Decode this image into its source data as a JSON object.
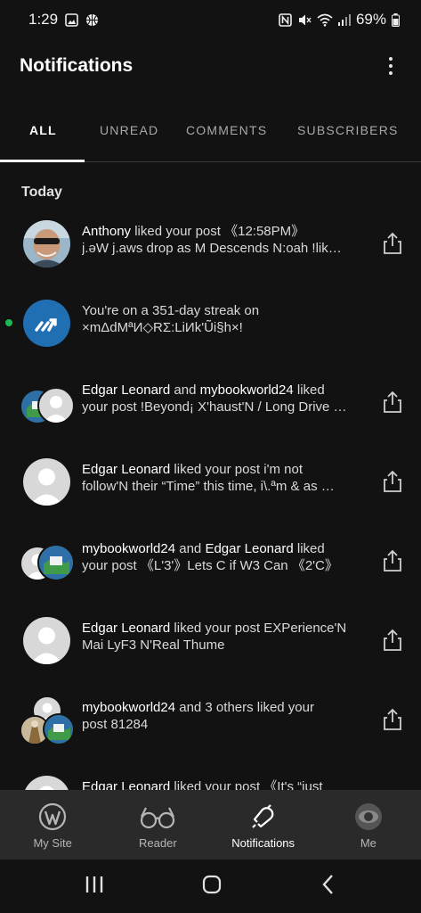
{
  "status_bar": {
    "time": "1:29",
    "battery": "69%"
  },
  "header": {
    "title": "Notifications"
  },
  "tabs": [
    {
      "label": "ALL"
    },
    {
      "label": "UNREAD"
    },
    {
      "label": "COMMENTS"
    },
    {
      "label": "SUBSCRIBERS"
    }
  ],
  "section": {
    "today": "Today"
  },
  "notifications": [
    {
      "line1_name": "Anthony",
      "line1_rest": " liked your post 《12:58PM》",
      "line2": "j.əW j.aws drop as M Descends N:oah !lik…"
    },
    {
      "line1_name": "",
      "line1_rest": "You're on a 351-day streak on",
      "line2": "×mΔdMªИ◇RΣ:LiИk'Ũi§h×!"
    },
    {
      "line1_name": "Edgar Leonard",
      "line1_rest": " and ",
      "line1_name2": "mybookworld24",
      "line1_tail": " liked",
      "line2": "your post !Beyond¡ X'haust'N / Long Drive …"
    },
    {
      "line1_name": "Edgar Leonard",
      "line1_rest": " liked your post i'm not",
      "line2": "follow'N their “Time” this time, i\\.ªm & as …"
    },
    {
      "line1_name": "mybookworld24",
      "line1_rest": " and ",
      "line1_name2": "Edgar Leonard",
      "line1_tail": " liked",
      "line2": "your post 《L'3'》Lets C if W3 Can 《2'C》"
    },
    {
      "line1_name": "Edgar Leonard",
      "line1_rest": " liked your post EXPerience'N",
      "line2": "Mai LyF3 N'Real Thume"
    },
    {
      "line1_name": "mybookworld24",
      "line1_rest": " and 3 others liked your",
      "line2": "post 81284"
    },
    {
      "line1_name": "Edgar Leonard",
      "line1_rest": " liked your post 《It's “just",
      "line2": ""
    }
  ],
  "bottom_nav": [
    {
      "label": "My Site"
    },
    {
      "label": "Reader"
    },
    {
      "label": "Notifications"
    },
    {
      "label": "Me"
    }
  ],
  "colors": {
    "background": "#121212",
    "nav_bg": "#2a2a2a",
    "streak_blue": "#1f6fb2",
    "unread_dot": "#1db954"
  }
}
